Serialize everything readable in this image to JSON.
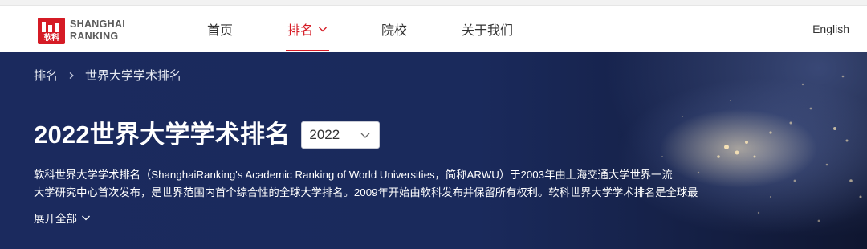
{
  "brand": {
    "logo_cn": "软科",
    "logo_line1": "SHANGHAI",
    "logo_line2": "RANKING",
    "accent_color": "#d51b25"
  },
  "nav": {
    "items": [
      {
        "label": "首页",
        "active": false
      },
      {
        "label": "排名",
        "active": true,
        "has_dropdown": true
      },
      {
        "label": "院校",
        "active": false
      },
      {
        "label": "关于我们",
        "active": false
      }
    ],
    "language_link": "English"
  },
  "breadcrumb": {
    "root": "排名",
    "current": "世界大学学术排名",
    "separator_icon": "chevron-right-icon"
  },
  "hero": {
    "title": "2022世界大学学术排名",
    "year_select": {
      "value": "2022",
      "icon": "chevron-down-icon"
    },
    "description_line1": "软科世界大学学术排名（ShanghaiRanking's Academic Ranking of World Universities，简称ARWU）于2003年由上海交通大学世界一流",
    "description_line2": "大学研究中心首次发布，是世界范围内首个综合性的全球大学排名。2009年开始由软科发布并保留所有权利。软科世界大学学术排名是全球最",
    "expand_label": "展开全部",
    "expand_icon": "chevron-down-icon"
  }
}
